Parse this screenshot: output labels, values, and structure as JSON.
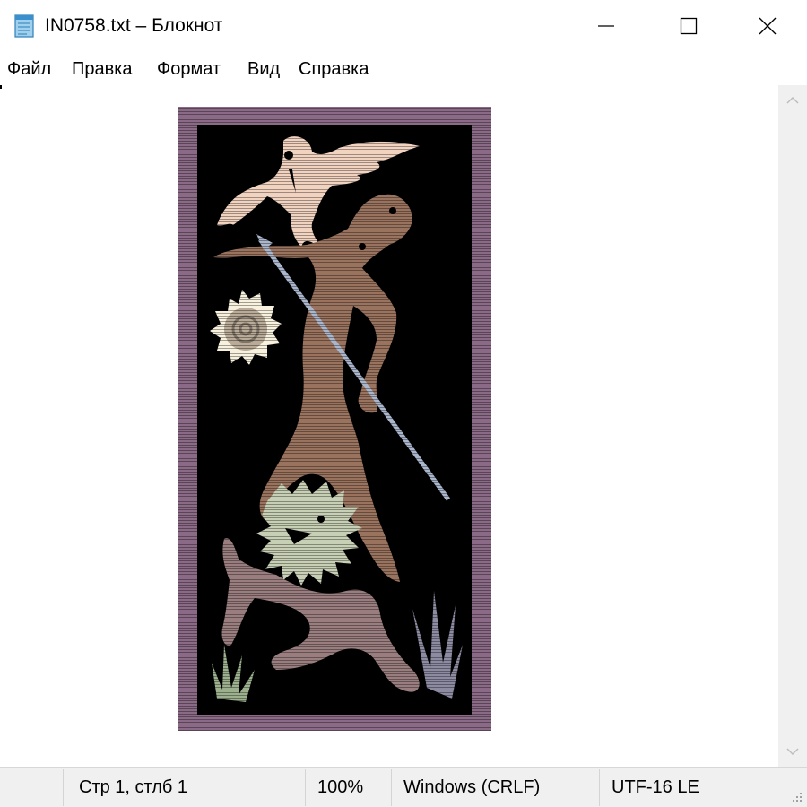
{
  "window": {
    "title": "IN0758.txt – Блокнот",
    "icons": {
      "app": "notepad-icon",
      "minimize": "minimize-icon",
      "maximize": "maximize-icon",
      "close": "close-icon"
    }
  },
  "menu": {
    "items": [
      {
        "label": "Файл"
      },
      {
        "label": "Правка"
      },
      {
        "label": "Формат"
      },
      {
        "label": "Вид"
      },
      {
        "label": "Справка"
      }
    ]
  },
  "editor": {
    "content_description_icon": "ascii-art-image",
    "colors": {
      "frame": "#8a6a86",
      "background": "#000000",
      "bird": "#f1d3c0",
      "man": "#9a735e",
      "creature_body": "#9a7e7f",
      "creature_mane": "#c7cfb5",
      "sun": "#f7f1dd",
      "spear": "#a9b6cc",
      "plant_green": "#9db08e",
      "plant_blue": "#8c8ba2"
    }
  },
  "scrollbar": {
    "up_icon": "chevron-up-icon",
    "down_icon": "chevron-down-icon"
  },
  "status": {
    "position": "Стр 1, стлб 1",
    "zoom": "100%",
    "line_endings": "Windows (CRLF)",
    "encoding": "UTF-16 LE",
    "grip_icon": "resize-grip-icon"
  }
}
